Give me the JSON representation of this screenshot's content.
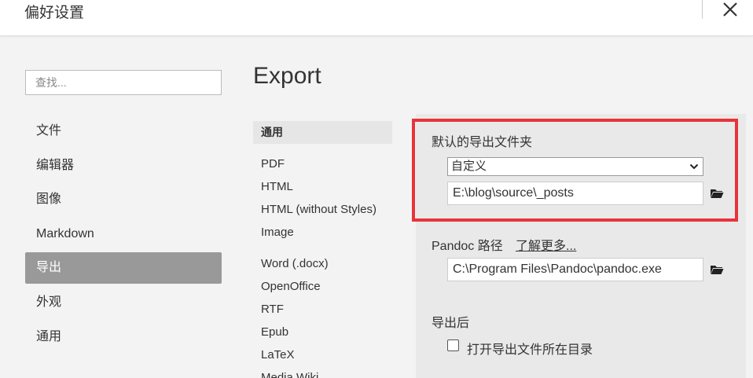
{
  "window": {
    "title": "偏好设置"
  },
  "search": {
    "placeholder": "查找..."
  },
  "nav": {
    "items": [
      "文件",
      "编辑器",
      "图像",
      "Markdown",
      "导出",
      "外观",
      "通用"
    ],
    "active_index": 4
  },
  "page": {
    "title": "Export"
  },
  "export_types": {
    "section_header": "通用",
    "group1": [
      "PDF",
      "HTML",
      "HTML (without Styles)",
      "Image"
    ],
    "group2": [
      "Word (.docx)",
      "OpenOffice",
      "RTF",
      "Epub",
      "LaTeX",
      "Media Wiki"
    ]
  },
  "settings": {
    "default_folder": {
      "label": "默认的导出文件夹",
      "mode_selected": "自定义",
      "path": "E:\\blog\\source\\_posts"
    },
    "pandoc": {
      "label": "Pandoc 路径",
      "learn_more": "了解更多...",
      "path": "C:\\Program Files\\Pandoc\\pandoc.exe"
    },
    "after_export": {
      "label": "导出后",
      "open_folder_label": "打开导出文件所在目录",
      "open_folder_checked": false
    }
  },
  "colors": {
    "highlight": "#e8333a",
    "active_nav": "#999999"
  },
  "icons": {
    "close": "close-icon",
    "folder": "folder-icon",
    "dropdown": "chevron-down-icon"
  }
}
